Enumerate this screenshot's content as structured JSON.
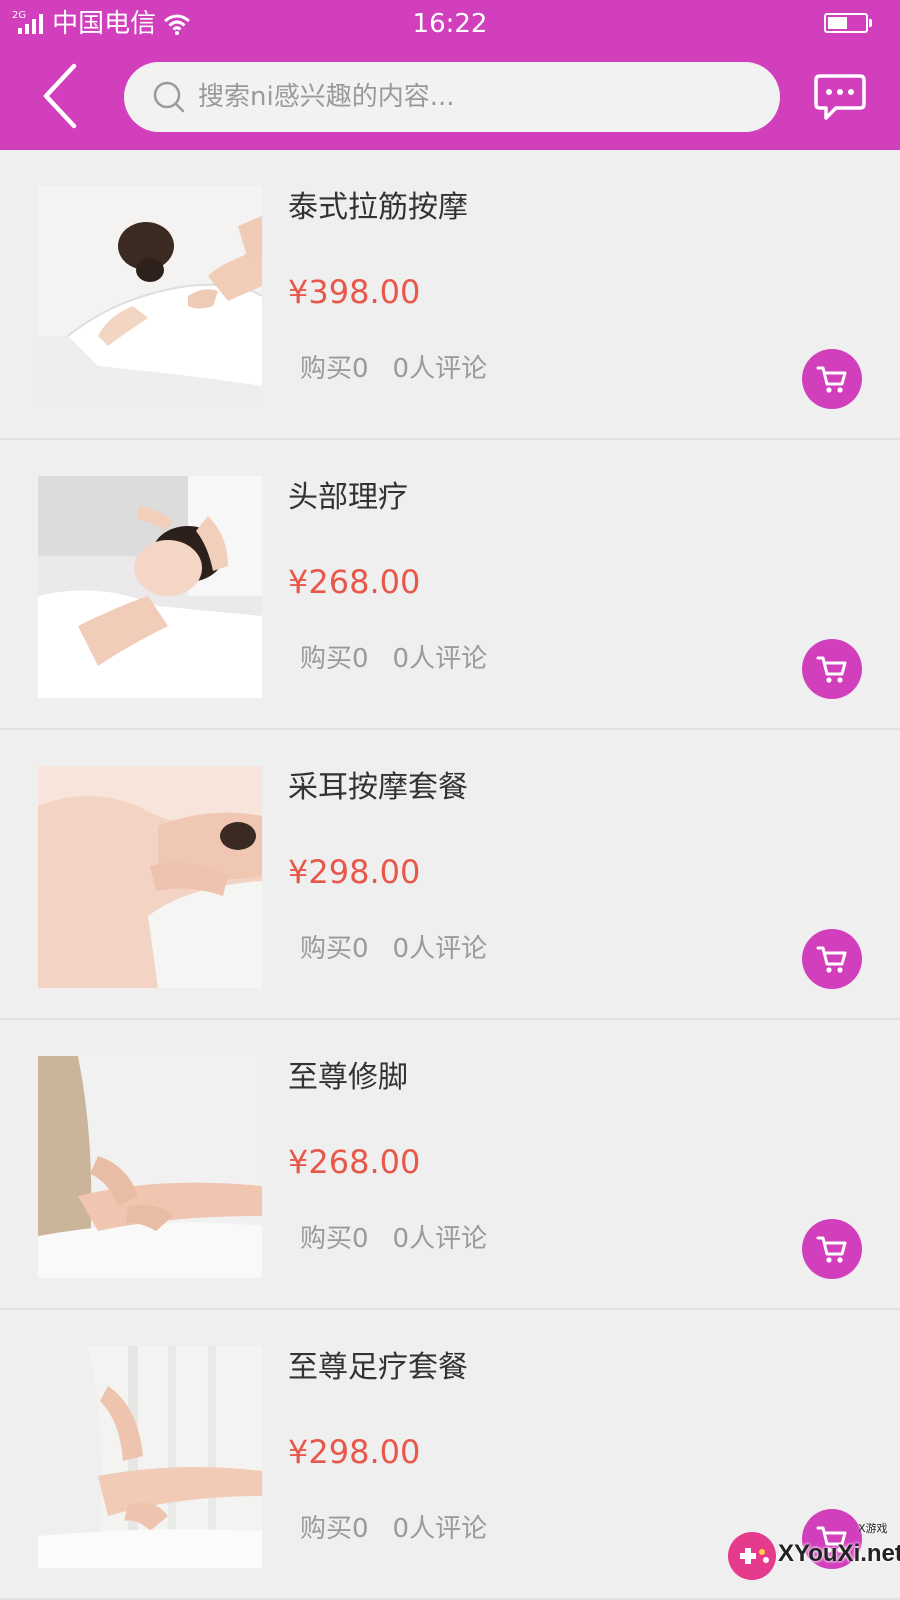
{
  "status_bar": {
    "network": "2G",
    "carrier": "中国电信",
    "time": "16:22"
  },
  "header": {
    "search_placeholder": "搜索ni感兴趣的内容...",
    "back_icon": "chevron-left-icon",
    "message_icon": "chat-bubble-icon"
  },
  "colors": {
    "brand": "#d13fbd",
    "price": "#e8584a",
    "background": "#f0eff0"
  },
  "products": [
    {
      "name": "泰式拉筋按摩",
      "price": "¥398.00",
      "purchases": "购买0",
      "reviews": "0人评论"
    },
    {
      "name": "头部理疗",
      "price": "¥268.00",
      "purchases": "购买0",
      "reviews": "0人评论"
    },
    {
      "name": "采耳按摩套餐",
      "price": "¥298.00",
      "purchases": "购买0",
      "reviews": "0人评论"
    },
    {
      "name": "至尊修脚",
      "price": "¥268.00",
      "purchases": "购买0",
      "reviews": "0人评论"
    },
    {
      "name": "至尊足疗套餐",
      "price": "¥298.00",
      "purchases": "购买0",
      "reviews": "0人评论"
    }
  ],
  "watermark": {
    "text": "XYouXi.net",
    "small": "X游戏"
  }
}
